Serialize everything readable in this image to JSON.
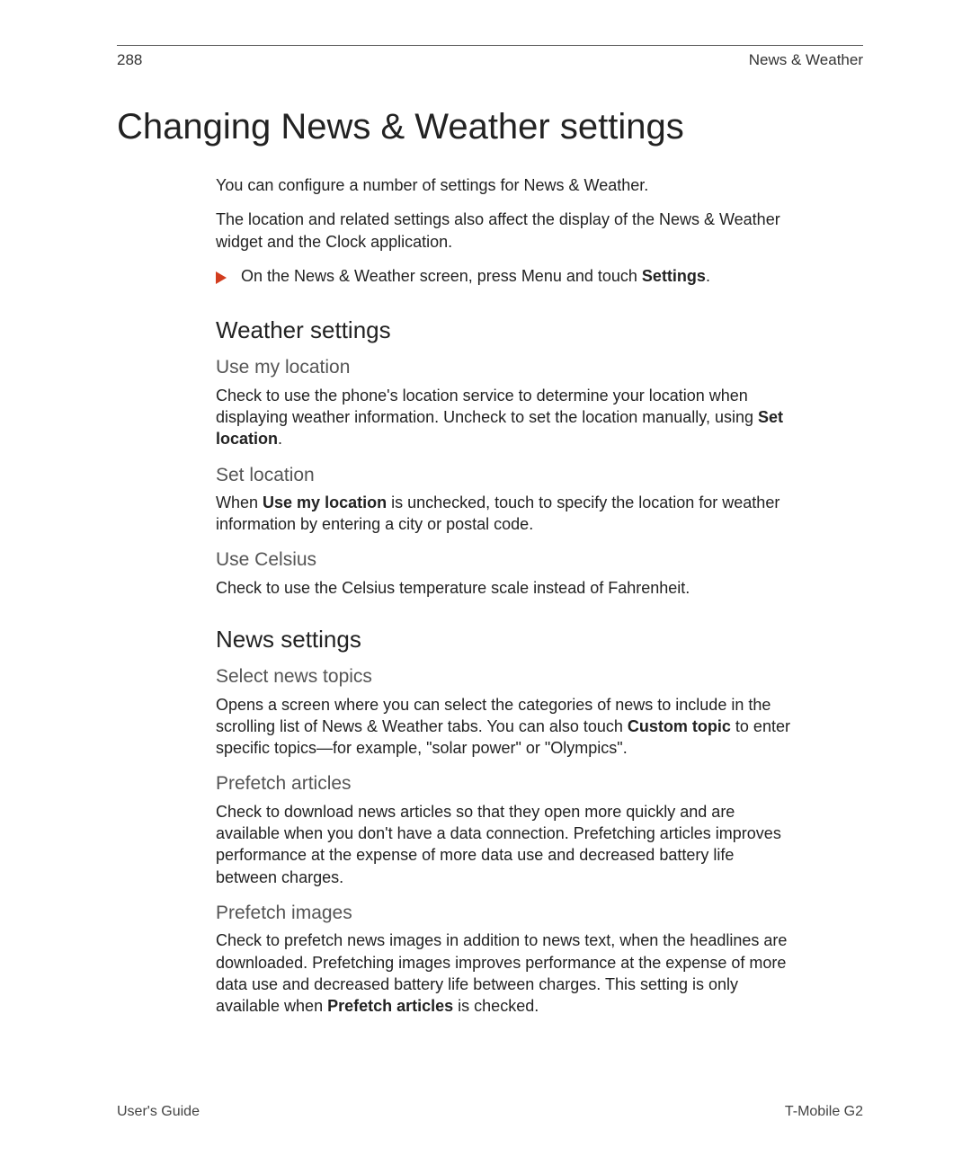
{
  "header": {
    "page_number": "288",
    "section": "News & Weather"
  },
  "title": "Changing News & Weather settings",
  "intro": {
    "p1": "You can configure a number of settings for News & Weather.",
    "p2": "The location and related settings also affect the display of the News & Weather widget and the Clock application.",
    "action_pre": "On the News & Weather screen, press ",
    "action_menu": "Menu",
    "action_mid": " and touch ",
    "action_settings": "Settings",
    "action_post": "."
  },
  "weather": {
    "heading": "Weather settings",
    "use_my_location": {
      "title": "Use my location",
      "body_pre": "Check to use the phone's location service to determine your location when displaying weather information. Uncheck to set the location manually, using ",
      "body_bold": "Set location",
      "body_post": "."
    },
    "set_location": {
      "title": "Set location",
      "body_pre": "When ",
      "body_bold": "Use my location",
      "body_post": " is unchecked, touch to specify the location for weather information by entering a city or postal code."
    },
    "use_celsius": {
      "title": "Use Celsius",
      "body": "Check to use the Celsius temperature scale instead of Fahrenheit."
    }
  },
  "news": {
    "heading": "News settings",
    "select_topics": {
      "title": "Select news topics",
      "body_pre": "Opens a screen where you can select the categories of news to include in the scrolling list of News & Weather tabs. You can also touch ",
      "body_bold": "Custom topic",
      "body_post": " to enter specific topics—for example, \"solar power\" or \"Olympics\"."
    },
    "prefetch_articles": {
      "title": "Prefetch articles",
      "body": "Check to download news articles so that they open more quickly and are available when you don't have a data connection. Prefetching articles improves performance at the expense of more data use and decreased battery life between charges."
    },
    "prefetch_images": {
      "title": "Prefetch images",
      "body_pre": "Check to prefetch news images in addition to news text, when the headlines are downloaded. Prefetching images improves performance at the expense of more data use and decreased battery life between charges. This setting is only available when ",
      "body_bold": "Prefetch articles",
      "body_post": " is checked."
    }
  },
  "footer": {
    "left": "User's Guide",
    "right": "T-Mobile G2"
  }
}
